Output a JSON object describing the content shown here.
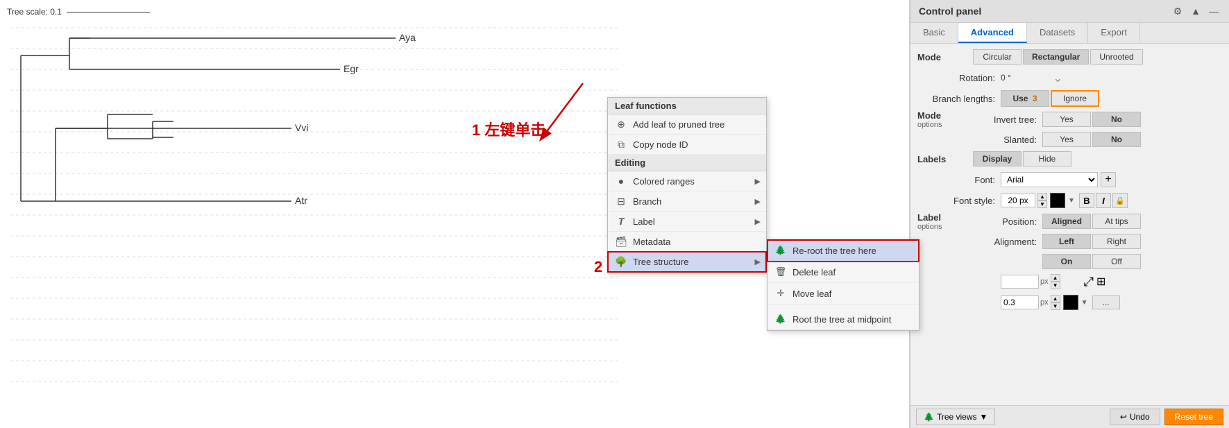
{
  "tree": {
    "scale_label": "Tree scale: 0.1",
    "leaf_labels": [
      "Aya",
      "Egr",
      "Vvi",
      "Atr"
    ],
    "annotation_1": "1 左键单击",
    "annotation_2": "2"
  },
  "context_menu": {
    "leaf_functions_header": "Leaf functions",
    "items_leaf": [
      {
        "icon": "⊕",
        "label": "Add leaf to pruned tree",
        "has_arrow": false
      },
      {
        "icon": "⧉",
        "label": "Copy node ID",
        "has_arrow": false
      }
    ],
    "editing_header": "Editing",
    "items_editing": [
      {
        "icon": "🌈",
        "label": "Colored ranges",
        "has_arrow": true
      },
      {
        "icon": "⊟",
        "label": "Branch",
        "has_arrow": true
      },
      {
        "icon": "T",
        "label": "Label",
        "has_arrow": true
      },
      {
        "icon": "🗃",
        "label": "Metadata",
        "has_arrow": false
      },
      {
        "icon": "🌳",
        "label": "Tree structure",
        "has_arrow": true,
        "highlighted": true
      }
    ]
  },
  "submenu": {
    "items": [
      {
        "icon": "🌲",
        "label": "Re-root the tree here",
        "active": true
      },
      {
        "icon": "🗑",
        "label": "Delete leaf"
      },
      {
        "icon": "✛",
        "label": "Move leaf"
      },
      {
        "icon": "separator"
      },
      {
        "icon": "🌲",
        "label": "Root the tree at midpoint"
      }
    ]
  },
  "control_panel": {
    "title": "Control panel",
    "tabs": [
      "Basic",
      "Advanced",
      "Datasets",
      "Export"
    ],
    "active_tab": "Advanced",
    "mode_label": "Mode",
    "mode_options": [
      "Circular",
      "Rectangular",
      "Unrooted"
    ],
    "mode_options_active": "Rectangular",
    "rotation_label": "Rotation:",
    "rotation_value": "0 °",
    "branch_lengths_label": "Branch lengths:",
    "branch_lengths_options": [
      "Use",
      "Ignore"
    ],
    "branch_use_badge": "3",
    "invert_tree_label": "Invert tree:",
    "invert_tree_options": [
      "Yes",
      "No"
    ],
    "slanted_label": "Slanted:",
    "slanted_options": [
      "Yes",
      "No"
    ],
    "labels_section": "Labels",
    "labels_options": [
      "Display",
      "Hide"
    ],
    "font_label": "Font:",
    "font_value": "Arial",
    "font_style_label": "Font style:",
    "font_size_value": "20 px",
    "label_options_section": "Label options",
    "position_label": "Position:",
    "position_options": [
      "Aligned",
      "At tips"
    ],
    "alignment_label": "Alignment:",
    "alignment_options": [
      "Left",
      "Right"
    ],
    "on_off_label": "",
    "on_off_options": [
      "On",
      "Off"
    ],
    "bottom_bar": {
      "tree_views_label": "Tree views",
      "undo_label": "Undo",
      "reset_label": "Reset tree"
    }
  }
}
